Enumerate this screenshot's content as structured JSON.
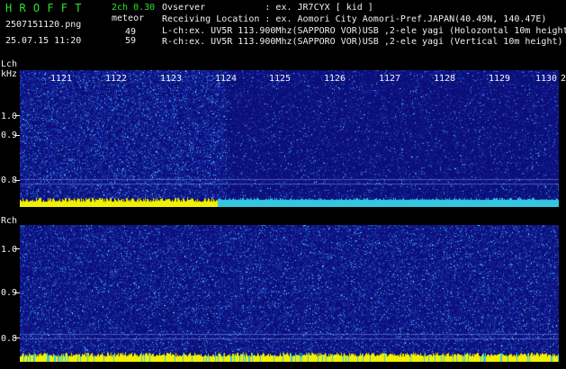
{
  "header": {
    "app_title": "H R O F F T",
    "channel_mode": "2ch 0.30",
    "meteor_label": "meteor",
    "filename": "2507151120.png",
    "datetime": "25.07.15 11:20",
    "lch_count": "49",
    "rch_count": "59",
    "observer_line": "Ovserver           : ex. JR7CYX [ kid ]",
    "location_line": "Receiving Location : ex. Aomori City Aomori-Pref.JAPAN(40.49N, 140.47E)",
    "lch_line": "L-ch:ex. UV5R 113.900Mhz(SAPPORO VOR)USB ,2-ele yagi (Holozontal 10m height)",
    "rch_line": "R-ch:ex. UV5R 113.900Mhz(SAPPORO VOR)USB ,2-ele yagi (Vertical 10m height)"
  },
  "axes": {
    "lch_label": "Lch",
    "khz_label": "kHz",
    "rch_label": "Rch",
    "y_ticks": [
      "1.0",
      "0.9",
      "0.8"
    ],
    "x_ticks": [
      "1121",
      "1122",
      "1123",
      "1124",
      "1125",
      "1126",
      "1127",
      "1128",
      "1129",
      "1130"
    ],
    "x_tick_overflow": "2"
  },
  "colors": {
    "background": "#000000",
    "spectrum_base": "#0c0f7a",
    "noise_cyan": "#33c8e0",
    "signal_yellow": "#f0f000",
    "label_green": "#30e030"
  }
}
